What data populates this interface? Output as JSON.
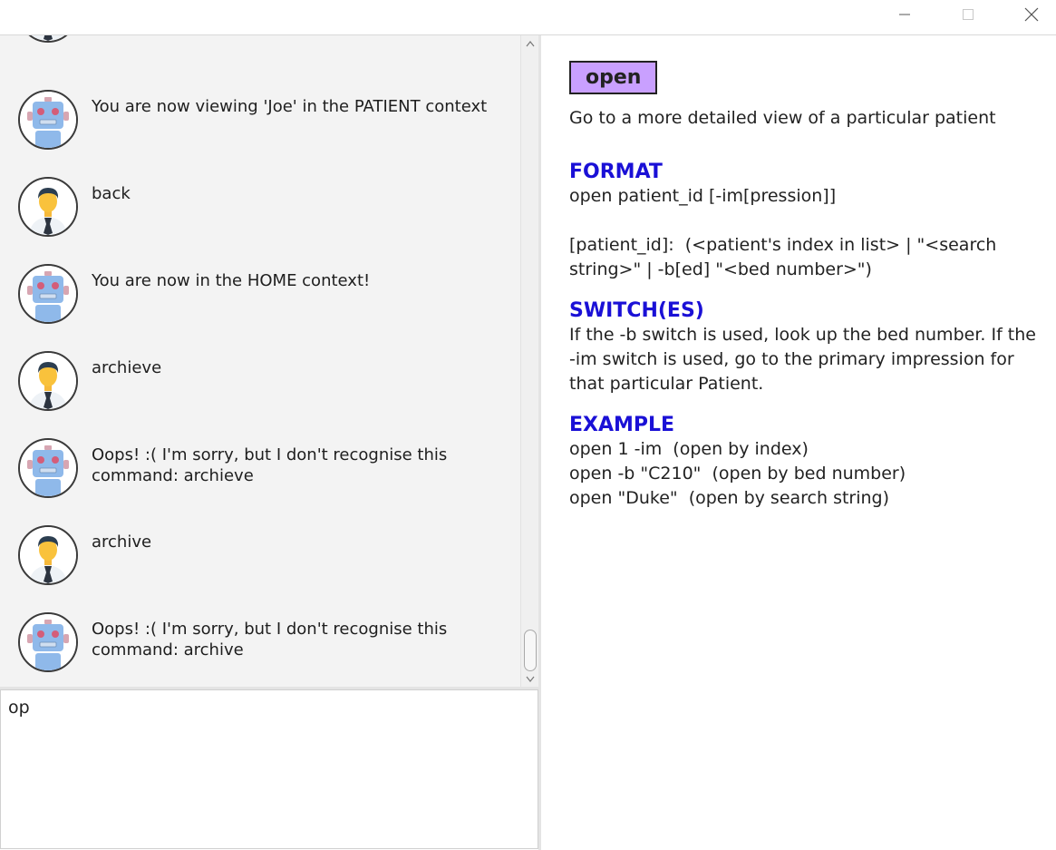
{
  "window": {
    "controls": [
      "minimize-icon",
      "maximize-icon",
      "close-icon"
    ]
  },
  "chat": {
    "messages": [
      {
        "sender": "user",
        "text": ""
      },
      {
        "sender": "bot",
        "text": "You are now viewing 'Joe' in the PATIENT context"
      },
      {
        "sender": "user",
        "text": "back"
      },
      {
        "sender": "bot",
        "text": "You are now in the HOME context!"
      },
      {
        "sender": "user",
        "text": "archieve"
      },
      {
        "sender": "bot",
        "text": "Oops! :( I'm sorry, but I don't recognise this command: archieve"
      },
      {
        "sender": "user",
        "text": "archive"
      },
      {
        "sender": "bot",
        "text": "Oops! :( I'm sorry, but I don't recognise this command: archive"
      }
    ]
  },
  "input": {
    "value": "op"
  },
  "help": {
    "command": "open",
    "description": "Go to a more detailed view of a particular patient",
    "format_heading": "FORMAT",
    "format_body": "open patient_id [-im[pression]]\n\n[patient_id]:  (<patient's index in list> | \"<search string>\" | -b[ed] \"<bed number>\")",
    "switches_heading": "SWITCH(ES)",
    "switches_body": "If the -b switch is used, look up the bed number. If the -im switch is used, go to the primary impression for that particular Patient.",
    "example_heading": "EXAMPLE",
    "example_body": "open 1 -im  (open by index)\nopen -b \"C210\"  (open by bed number)\nopen \"Duke\"  (open by search string)"
  },
  "colors": {
    "badge": "#c9a0ff",
    "heading": "#1a10d6",
    "chat_bg": "#f3f3f3"
  }
}
